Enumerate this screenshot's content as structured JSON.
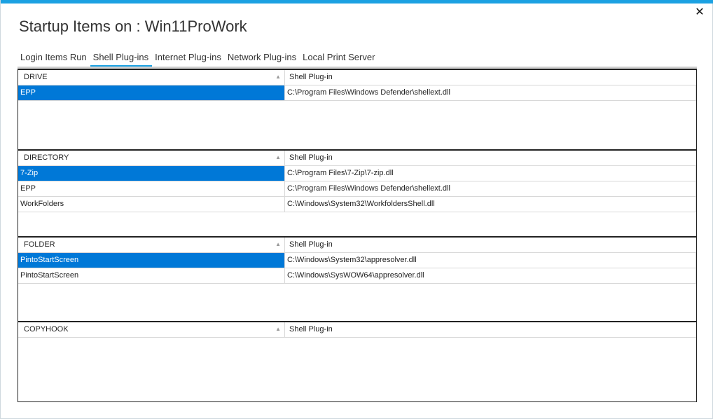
{
  "window": {
    "title": "Startup Items on : Win11ProWork",
    "close_glyph": "✕",
    "close_icon": "close-icon"
  },
  "tabs": [
    {
      "label": "Login Items Run",
      "active": false
    },
    {
      "label": "Shell Plug-ins",
      "active": true
    },
    {
      "label": "Internet Plug-ins",
      "active": false
    },
    {
      "label": "Network Plug-ins",
      "active": false
    },
    {
      "label": "Local Print Server",
      "active": false
    }
  ],
  "colors": {
    "accent": "#1ba1e2",
    "selection": "#0078d7"
  },
  "groups": [
    {
      "name": "DRIVE",
      "column": "Shell Plug-in",
      "rows": [
        {
          "name": "EPP",
          "path": "C:\\Program Files\\Windows Defender\\shellext.dll",
          "selected": true
        }
      ]
    },
    {
      "name": "DIRECTORY",
      "column": "Shell Plug-in",
      "rows": [
        {
          "name": "7-Zip",
          "path": "C:\\Program Files\\7-Zip\\7-zip.dll",
          "selected": true
        },
        {
          "name": "EPP",
          "path": "C:\\Program Files\\Windows Defender\\shellext.dll",
          "selected": false
        },
        {
          "name": "WorkFolders",
          "path": "C:\\Windows\\System32\\WorkfoldersShell.dll",
          "selected": false
        }
      ]
    },
    {
      "name": "FOLDER",
      "column": "Shell Plug-in",
      "rows": [
        {
          "name": "PintoStartScreen",
          "path": "C:\\Windows\\System32\\appresolver.dll",
          "selected": true
        },
        {
          "name": "PintoStartScreen",
          "path": "C:\\Windows\\SysWOW64\\appresolver.dll",
          "selected": false
        }
      ]
    },
    {
      "name": "COPYHOOK",
      "column": "Shell Plug-in",
      "rows": []
    }
  ]
}
